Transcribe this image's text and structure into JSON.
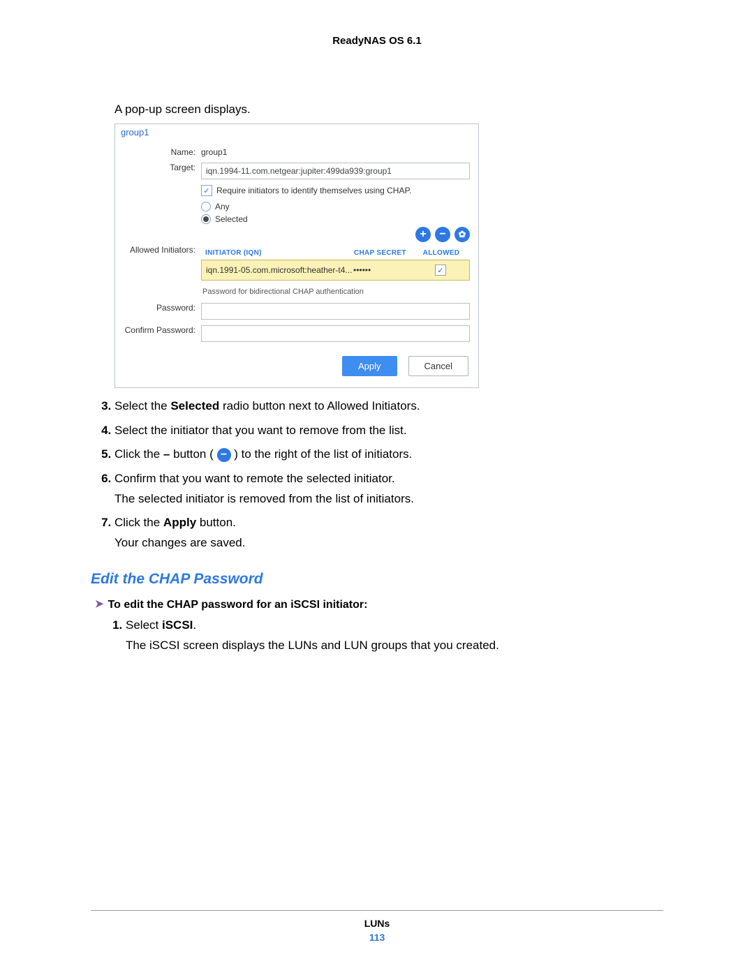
{
  "header": {
    "product": "ReadyNAS OS 6.1"
  },
  "intro": "A pop-up screen displays.",
  "dialog": {
    "tab": "group1",
    "name_label": "Name:",
    "name_value": "group1",
    "target_label": "Target:",
    "target_value": "iqn.1994-11.com.netgear:jupiter:499da939:group1",
    "require_chap": "Require initiators to identify themselves using CHAP.",
    "allowed_label": "Allowed Initiators:",
    "radio_any": "Any",
    "radio_selected": "Selected",
    "headers": {
      "iqn": "INITIATOR (IQN)",
      "secret": "CHAP SECRET",
      "allowed": "ALLOWED"
    },
    "row": {
      "iqn": "iqn.1991-05.com.microsoft:heather-t4...",
      "secret": "••••••",
      "allowed": "✓"
    },
    "pw_caption": "Password for bidirectional CHAP authentication",
    "password_label": "Password:",
    "confirm_label": "Confirm Password:",
    "apply": "Apply",
    "cancel": "Cancel"
  },
  "steps_a": [
    {
      "n": 3,
      "pre": "Select the ",
      "bold": "Selected",
      "post": " radio button next to Allowed Initiators."
    },
    {
      "n": 4,
      "text": "Select the initiator that you want to remove from the list."
    },
    {
      "n": 5,
      "pre": "Click the ",
      "mid": " button ( ",
      "post": " ) to the right of the list of initiators.",
      "dash": "–"
    },
    {
      "n": 6,
      "text": "Confirm that you want to remote the selected initiator.",
      "follow": "The selected initiator is removed from the list of initiators."
    },
    {
      "n": 7,
      "pre": "Click the ",
      "bold": "Apply",
      "post": " button.",
      "follow": "Your changes are saved."
    }
  ],
  "section_title": "Edit the CHAP Password",
  "task_line": "To edit the CHAP password for an iSCSI initiator:",
  "steps_b": [
    {
      "n": 1,
      "pre": "Select ",
      "bold": "iSCSI",
      "post": ".",
      "follow": "The iSCSI screen displays the LUNs and LUN groups that you created."
    }
  ],
  "footer": {
    "section": "LUNs",
    "page": "113"
  }
}
